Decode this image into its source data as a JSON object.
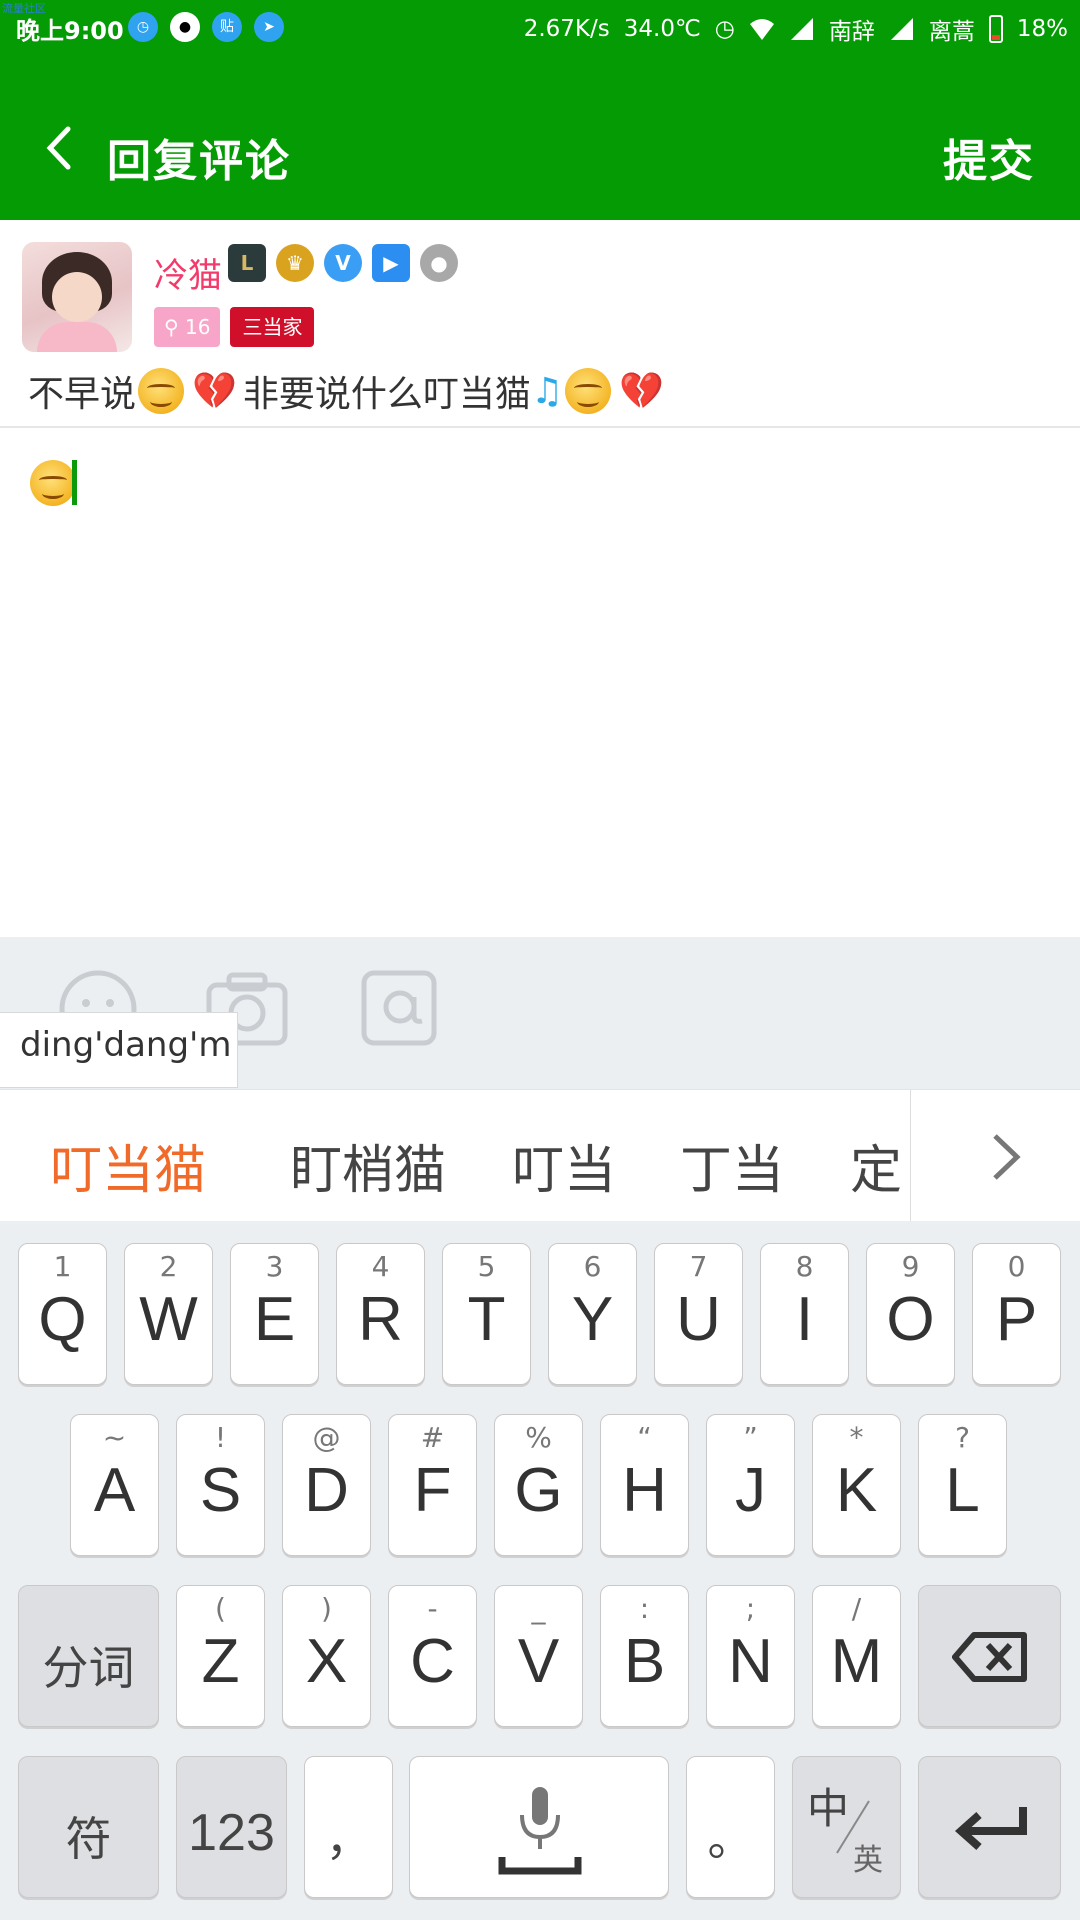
{
  "status": {
    "corner_label": "流量社区",
    "time": "晚上9:00",
    "tieba_icon_label": "贴",
    "speed": "2.67K/s",
    "temp": "34.0℃",
    "carrier1": "南辞",
    "carrier2": "离蒿",
    "battery": "18%"
  },
  "appbar": {
    "title": "回复评论",
    "submit": "提交"
  },
  "post": {
    "username": "冷猫",
    "level": "16",
    "title_tag": "三当家",
    "comment_parts": [
      "不早说",
      "非要说什么叮当猫"
    ]
  },
  "ime": {
    "pinyin": "ding'dang'm",
    "candidates": [
      "叮当猫",
      "盯梢猫",
      "叮当",
      "丁当",
      "定"
    ]
  },
  "keyboard": {
    "row1": [
      {
        "sub": "1",
        "main": "Q"
      },
      {
        "sub": "2",
        "main": "W"
      },
      {
        "sub": "3",
        "main": "E"
      },
      {
        "sub": "4",
        "main": "R"
      },
      {
        "sub": "5",
        "main": "T"
      },
      {
        "sub": "6",
        "main": "Y"
      },
      {
        "sub": "7",
        "main": "U"
      },
      {
        "sub": "8",
        "main": "I"
      },
      {
        "sub": "9",
        "main": "O"
      },
      {
        "sub": "0",
        "main": "P"
      }
    ],
    "row2": [
      {
        "sub": "~",
        "main": "A"
      },
      {
        "sub": "!",
        "main": "S"
      },
      {
        "sub": "@",
        "main": "D"
      },
      {
        "sub": "#",
        "main": "F"
      },
      {
        "sub": "%",
        "main": "G"
      },
      {
        "sub": "“",
        "main": "H"
      },
      {
        "sub": "”",
        "main": "J"
      },
      {
        "sub": "*",
        "main": "K"
      },
      {
        "sub": "?",
        "main": "L"
      }
    ],
    "row3": [
      {
        "sub": "(",
        "main": "Z"
      },
      {
        "sub": ")",
        "main": "X"
      },
      {
        "sub": "-",
        "main": "C"
      },
      {
        "sub": "_",
        "main": "V"
      },
      {
        "sub": ":",
        "main": "B"
      },
      {
        "sub": ";",
        "main": "N"
      },
      {
        "sub": "/",
        "main": "M"
      }
    ],
    "segment_label": "分词",
    "symbol_label": "符",
    "num_label": "123",
    "comma": "，",
    "period": "。",
    "lang_zh": "中",
    "lang_en": "英"
  },
  "colors": {
    "brand": "#059b05",
    "selected_candidate": "#f06a2a",
    "username": "#f23b6a"
  }
}
